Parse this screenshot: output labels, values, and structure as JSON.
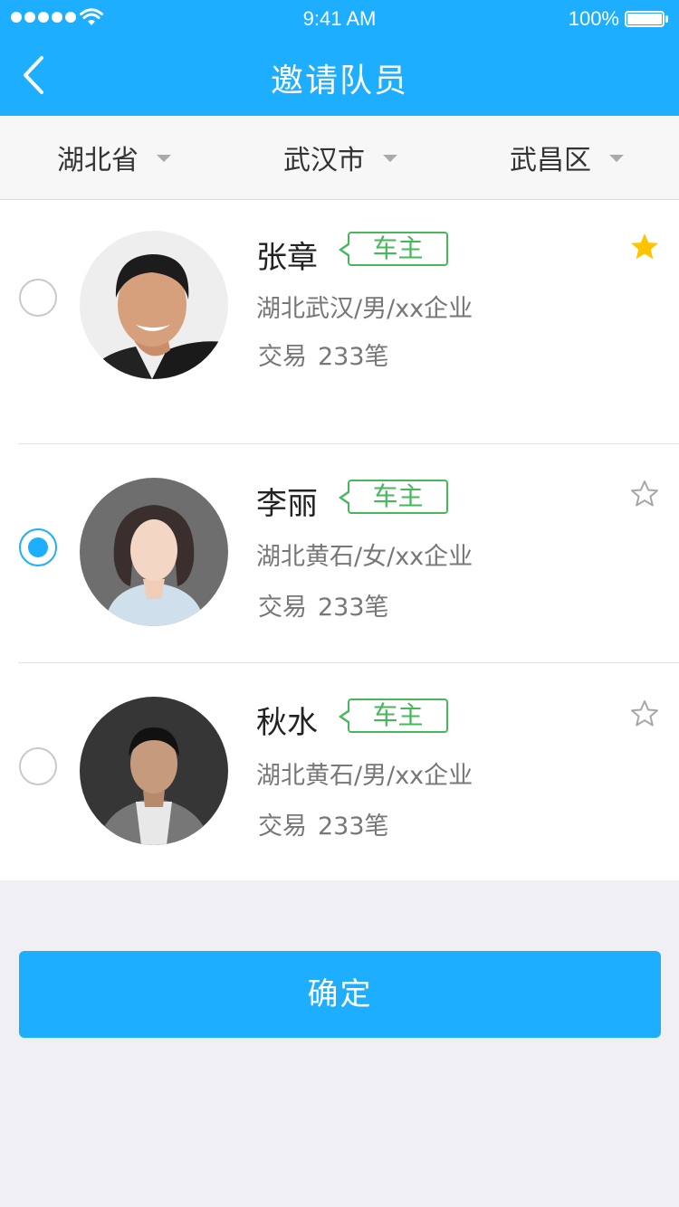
{
  "status_bar": {
    "time": "9:41 AM",
    "battery": "100%"
  },
  "nav": {
    "title": "邀请队员"
  },
  "filters": [
    {
      "label": "湖北省"
    },
    {
      "label": "武汉市"
    },
    {
      "label": "武昌区"
    }
  ],
  "members": [
    {
      "name": "张章",
      "tag": "车主",
      "info": "湖北武汉/男/xx企业",
      "trades_label": "交易",
      "trades_count": "233笔",
      "selected": false,
      "starred": true
    },
    {
      "name": "李丽",
      "tag": "车主",
      "info": "湖北黄石/女/xx企业",
      "trades_label": "交易",
      "trades_count": "233笔",
      "selected": true,
      "starred": false
    },
    {
      "name": "秋水",
      "tag": "车主",
      "info": "湖北黄石/男/xx企业",
      "trades_label": "交易",
      "trades_count": "233笔",
      "selected": false,
      "starred": false
    }
  ],
  "confirm_label": "确定",
  "colors": {
    "primary": "#1daeff",
    "tag_green": "#45b85a",
    "star_gold": "#ffc400",
    "background": "#efeff4"
  }
}
